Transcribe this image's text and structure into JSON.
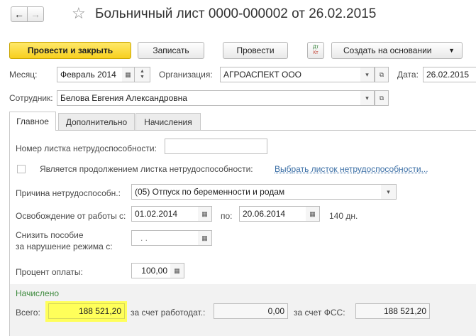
{
  "window": {
    "title": "Больничный лист 0000-000002 от 26.02.2015"
  },
  "toolbar": {
    "post_close": "Провести и закрыть",
    "save": "Записать",
    "post": "Провести",
    "dtkt": "Дт Кт",
    "create_based": "Создать на основании"
  },
  "header": {
    "month_label": "Месяц:",
    "month_value": "Февраль 2014",
    "org_label": "Организация:",
    "org_value": "АГРОАСПЕКТ ООО",
    "date_label": "Дата:",
    "date_value": "26.02.2015",
    "employee_label": "Сотрудник:",
    "employee_value": "Белова Евгения Александровна"
  },
  "tabs": [
    "Главное",
    "Дополнительно",
    "Начисления"
  ],
  "main": {
    "sheet_number_label": "Номер листка нетрудоспособности:",
    "sheet_number_value": "",
    "continuation_label": "Является продолжением листка нетрудоспособности:",
    "continuation_link": "Выбрать листок нетрудоспособности...",
    "reason_label": "Причина нетрудоспособн.:",
    "reason_value": "(05) Отпуск по беременности и родам",
    "release_label": "Освобождение от работы с:",
    "release_from": "01.02.2014",
    "release_to_label": "по:",
    "release_to": "20.06.2014",
    "days": "140 дн.",
    "reduce_label_1": "Снизить пособие",
    "reduce_label_2": "за нарушение режима с:",
    "reduce_value": ". .",
    "percent_label": "Процент оплаты:",
    "percent_value": "100,00"
  },
  "accrued": {
    "section_label": "Начислено",
    "total_label": "Всего:",
    "total_value": "188 521,20",
    "employer_label": "за счет работодат.:",
    "employer_value": "0,00",
    "fss_label": "за счет ФСС:",
    "fss_value": "188 521,20"
  },
  "colors": {
    "highlight": "#ffff5a",
    "link": "#3a6ea5",
    "section_title": "#3d8a3d",
    "primary_button": "#f7cf1e"
  }
}
